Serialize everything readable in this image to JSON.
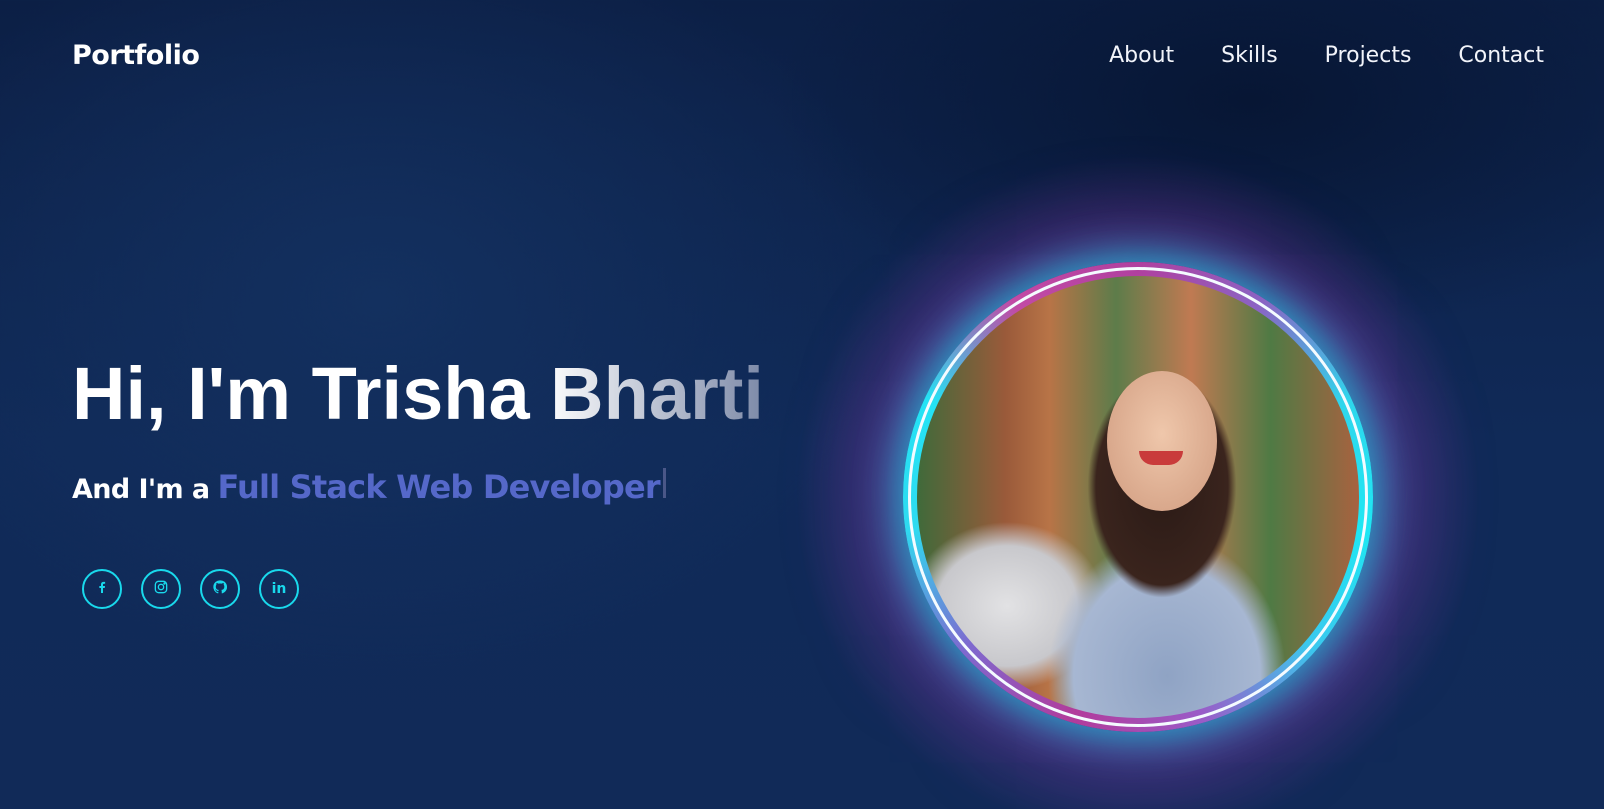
{
  "navbar": {
    "logo": "Portfolio",
    "links": [
      "About",
      "Skills",
      "Projects",
      "Contact"
    ]
  },
  "hero": {
    "greeting": "Hi, I'm Trisha Bharti",
    "role_prefix": "And I'm a",
    "role_typed": "Full Stack Web Developer"
  },
  "socials": {
    "icons": [
      "facebook-icon",
      "instagram-icon",
      "github-icon",
      "linkedin-icon"
    ],
    "linkedin_text": "in"
  },
  "colors": {
    "accent": "#19d9ec",
    "role_text": "#5568c9",
    "background": "#0f2550",
    "ring_magenta": "#b0409f"
  }
}
